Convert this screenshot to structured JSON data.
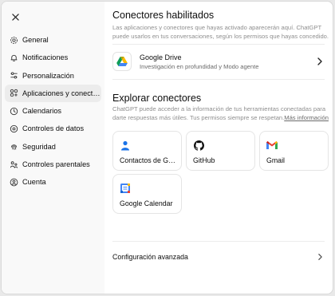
{
  "sidebar": {
    "close_icon": "close-icon",
    "items": [
      {
        "label": "General",
        "icon": "gear-icon",
        "active": false
      },
      {
        "label": "Notificaciones",
        "icon": "bell-icon",
        "active": false
      },
      {
        "label": "Personalización",
        "icon": "sliders-icon",
        "active": false
      },
      {
        "label": "Aplicaciones y conectores",
        "icon": "apps-icon",
        "active": true
      },
      {
        "label": "Calendarios",
        "icon": "clock-icon",
        "active": false
      },
      {
        "label": "Controles de datos",
        "icon": "data-controls-icon",
        "active": false
      },
      {
        "label": "Seguridad",
        "icon": "fingerprint-icon",
        "active": false
      },
      {
        "label": "Controles parentales",
        "icon": "parental-icon",
        "active": false
      },
      {
        "label": "Cuenta",
        "icon": "account-icon",
        "active": false
      }
    ]
  },
  "enabled": {
    "title": "Conectores habilitados",
    "description": "Las aplicaciones y conectores que hayas activado aparecerán aquí. ChatGPT puede usarlos en tus conversaciones, según los permisos que hayas concedido.",
    "drive": {
      "name": "Google Drive",
      "subtitle": "Investigación en profundidad y Modo agente"
    }
  },
  "explore": {
    "title": "Explorar conectores",
    "description": "ChatGPT puede acceder a la información de tus herramientas conectadas para darte respuestas más útiles. Tus permisos siempre se respetan.",
    "link": "Más información",
    "cards": [
      {
        "label": "Contactos de Google",
        "icon": "google-contacts-icon"
      },
      {
        "label": "GitHub",
        "icon": "github-icon"
      },
      {
        "label": "Gmail",
        "icon": "gmail-icon"
      },
      {
        "label": "Google Calendar",
        "icon": "google-calendar-icon"
      }
    ]
  },
  "advanced": {
    "label": "Configuración avanzada"
  },
  "colors": {
    "sidebar_bg": "#f9f9f9",
    "active_bg": "#ececec",
    "muted_text": "#8f8f8f"
  }
}
